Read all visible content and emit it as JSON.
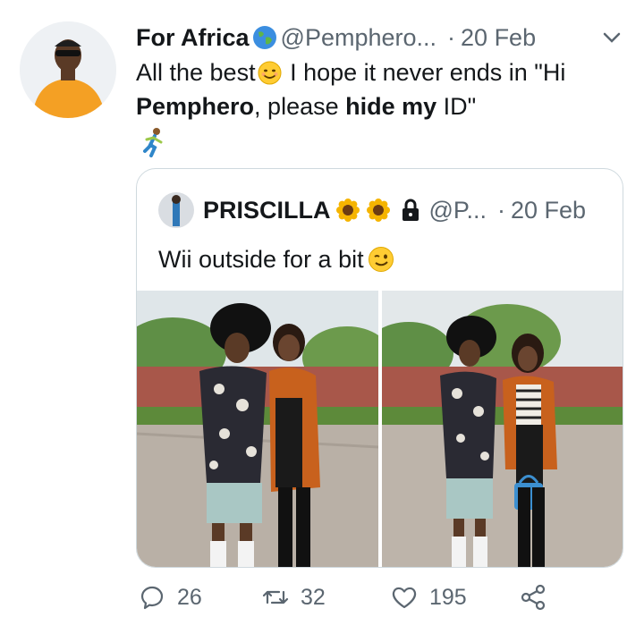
{
  "tweet": {
    "display_name": "For Africa",
    "handle": "@Pemphero...",
    "date": "20 Feb",
    "dot": "·",
    "text_1": "All the best",
    "text_2": " I hope it never ends in \"Hi ",
    "text_bold_1": "Pemphero",
    "text_3": ", please ",
    "text_bold_2": "hide my",
    "text_4": " ID\"",
    "emoji_after_name": "globe-icon",
    "emoji_in_text": "smiling-face-icon",
    "emoji_line": "person-running-icon"
  },
  "quoted": {
    "display_name": "PRISCILLA",
    "handle": "@P...",
    "date": "20 Feb",
    "dot": "·",
    "text": "Wii outside for a bit",
    "emoji": "winking-face-icon",
    "name_icons": [
      "sunflower-icon",
      "sunflower-icon",
      "lock-icon"
    ]
  },
  "actions": {
    "replies": "26",
    "retweets": "32",
    "likes": "195"
  },
  "colors": {
    "text": "#14171a",
    "muted": "#5b6670",
    "border": "#cfd9de"
  }
}
